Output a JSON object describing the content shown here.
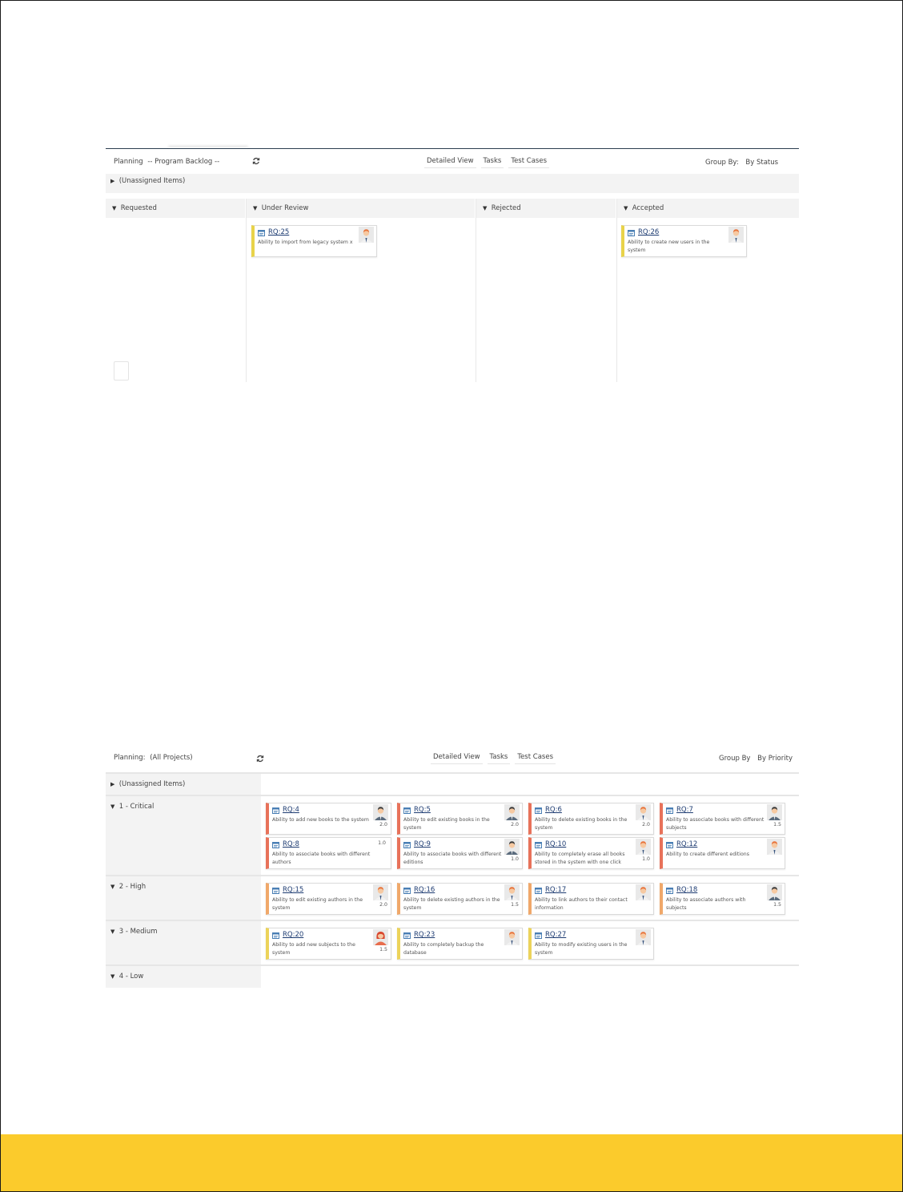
{
  "colors": {
    "footer": "#fbcb2c",
    "critical": "#e8725a",
    "high": "#f0a86a",
    "medium": "#ecd35a",
    "link": "#1e3c72"
  },
  "panel1": {
    "planning_label": "Planning",
    "planning_value": "-- Program Backlog --",
    "refresh_icon": "refresh-icon",
    "tabs": [
      "Detailed View",
      "Tasks",
      "Test Cases"
    ],
    "group_by_label": "Group By",
    "group_by_value": "By Status",
    "unassigned_label": "(Unassigned Items)",
    "columns": [
      "Requested",
      "Under Review",
      "Rejected",
      "Accepted"
    ],
    "cards": [
      {
        "code": "RQ:25",
        "desc": "Ability to import from legacy system x",
        "avatar": "male-orange",
        "column": "Under Review",
        "points": ""
      },
      {
        "code": "RQ:26",
        "desc": "Ability to create new users in the system",
        "avatar": "male-orange",
        "column": "Accepted",
        "points": ""
      }
    ]
  },
  "panel2": {
    "planning_label": "Planning",
    "planning_value": "(All Projects)",
    "refresh_icon": "refresh-icon",
    "tabs": [
      "Detailed View",
      "Tasks",
      "Test Cases"
    ],
    "group_by_label": "Group By",
    "group_by_value": "By Priority",
    "unassigned_label": "(Unassigned Items)",
    "rows": [
      {
        "label": "1 - Critical",
        "priority": "critical",
        "cards": [
          {
            "code": "RQ:4",
            "desc": "Ability to add new books to the system",
            "avatar": "male-dark",
            "points": "2.0"
          },
          {
            "code": "RQ:5",
            "desc": "Ability to edit existing books in the system",
            "avatar": "male-dark",
            "points": "2.0"
          },
          {
            "code": "RQ:6",
            "desc": "Ability to delete existing books in the system",
            "avatar": "male-orange",
            "points": "2.0"
          },
          {
            "code": "RQ:7",
            "desc": "Ability to associate books with different subjects",
            "avatar": "male-dark",
            "points": "1.5"
          },
          {
            "code": "RQ:8",
            "desc": "Ability to associate books with different authors",
            "avatar": "none",
            "points": "1.0"
          },
          {
            "code": "RQ:9",
            "desc": "Ability to associate books with different editions",
            "avatar": "male-dark",
            "points": "1.0"
          },
          {
            "code": "RQ:10",
            "desc": "Ability to completely erase all books stored in the system with one click",
            "avatar": "male-orange",
            "points": "1.0"
          },
          {
            "code": "RQ:12",
            "desc": "Ability to create different editions",
            "avatar": "male-orange",
            "points": ""
          }
        ]
      },
      {
        "label": "2 - High",
        "priority": "high",
        "cards": [
          {
            "code": "RQ:15",
            "desc": "Ability to edit existing authors in the system",
            "avatar": "male-orange",
            "points": "2.0"
          },
          {
            "code": "RQ:16",
            "desc": "Ability to delete existing authors in the system",
            "avatar": "male-orange",
            "points": "1.5"
          },
          {
            "code": "RQ:17",
            "desc": "Ability to link authors to their contact information",
            "avatar": "male-orange",
            "points": ""
          },
          {
            "code": "RQ:18",
            "desc": "Ability to associate authors with subjects",
            "avatar": "male-dark",
            "points": "1.5"
          }
        ]
      },
      {
        "label": "3 - Medium",
        "priority": "medium",
        "cards": [
          {
            "code": "RQ:20",
            "desc": "Ability to add new subjects to the system",
            "avatar": "female-red",
            "points": "1.5"
          },
          {
            "code": "RQ:23",
            "desc": "Ability to completely backup the database",
            "avatar": "male-orange",
            "points": ""
          },
          {
            "code": "RQ:27",
            "desc": "Ability to modify existing users in the system",
            "avatar": "male-orange",
            "points": ""
          }
        ]
      },
      {
        "label": "4 - Low",
        "priority": "low",
        "cards": []
      }
    ]
  }
}
